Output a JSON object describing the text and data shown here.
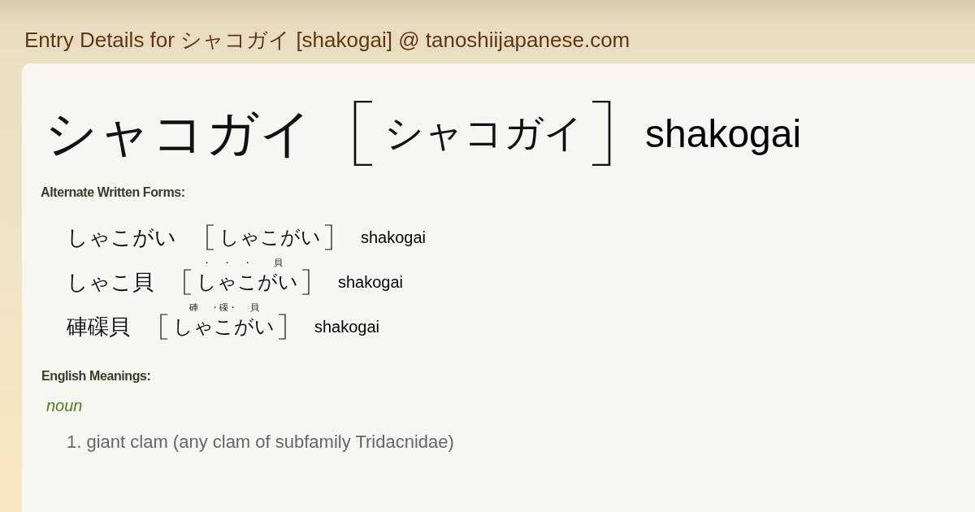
{
  "page_title": "Entry Details for シャコガイ [shakogai] @ tanoshiijapanese.com",
  "entry": {
    "word": "シャコガイ",
    "reading": "シャコガイ",
    "romaji": "shakogai"
  },
  "alternate_forms": {
    "heading": "Alternate Written Forms:",
    "items": [
      {
        "written": "しゃこがい",
        "reading": [
          {
            "base": "しゃこがい"
          }
        ],
        "romaji": "shakogai"
      },
      {
        "written": "しゃこ貝",
        "reading": [
          {
            "base": "し",
            "ruby": "・"
          },
          {
            "base": "ゃ",
            "ruby": "・"
          },
          {
            "base": "こ",
            "ruby": "・"
          },
          {
            "base": "がい",
            "ruby": "貝"
          }
        ],
        "romaji": "shakogai"
      },
      {
        "written": "硨磲貝",
        "reading": [
          {
            "base": "しゃ",
            "ruby": "硨"
          },
          {
            "base": "こ",
            "ruby": "・磲・"
          },
          {
            "base": "がい",
            "ruby": "貝"
          }
        ],
        "romaji": "shakogai"
      }
    ]
  },
  "meanings": {
    "heading": "English Meanings:",
    "groups": [
      {
        "part_of_speech": "noun",
        "senses": [
          "1. giant clam (any clam of subfamily Tridacnidae)"
        ]
      }
    ]
  }
}
